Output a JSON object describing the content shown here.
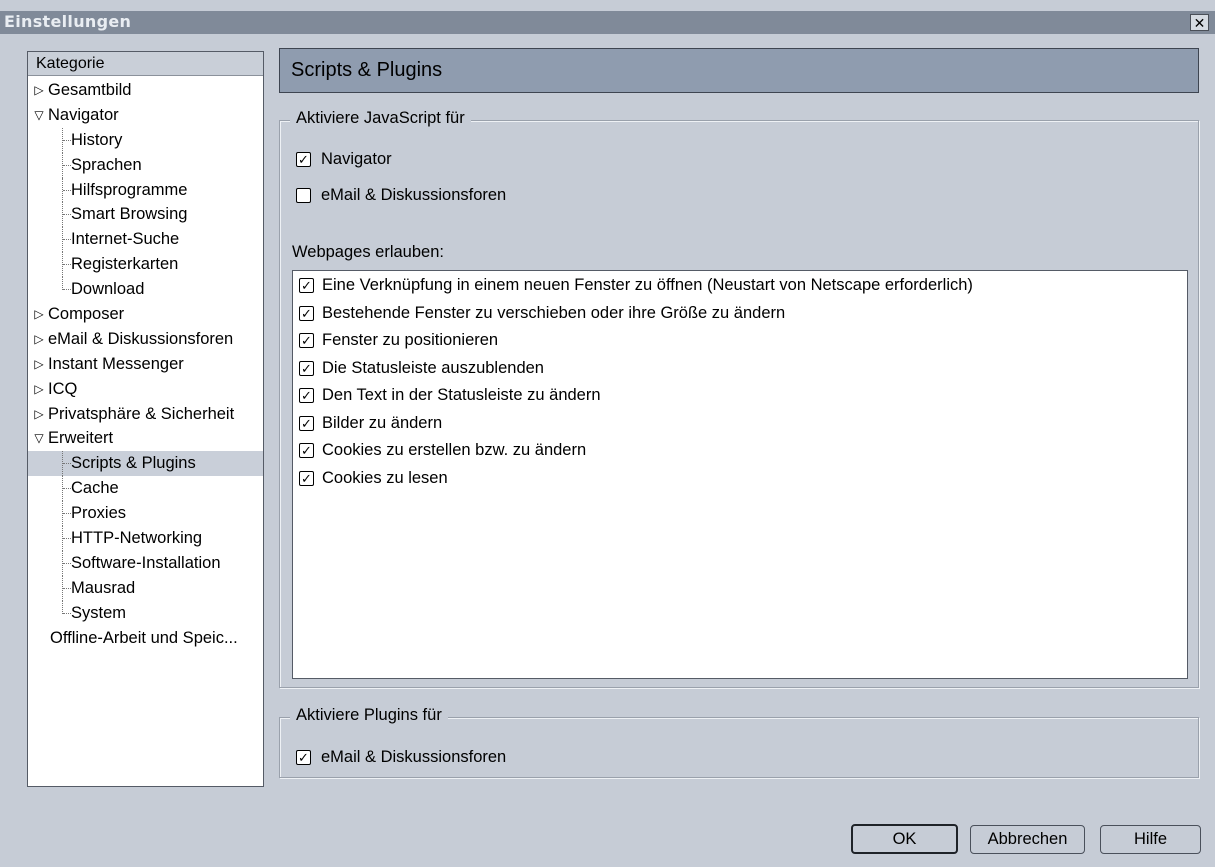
{
  "window": {
    "title": "Einstellungen",
    "close_glyph": "✕"
  },
  "tree": {
    "header": "Kategorie",
    "items": [
      {
        "label": "Gesamtbild",
        "level": "top",
        "arrow": "right"
      },
      {
        "label": "Navigator",
        "level": "top",
        "arrow": "down"
      },
      {
        "label": "History",
        "level": "sub"
      },
      {
        "label": "Sprachen",
        "level": "sub"
      },
      {
        "label": "Hilfsprogramme",
        "level": "sub"
      },
      {
        "label": "Smart Browsing",
        "level": "sub"
      },
      {
        "label": "Internet-Suche",
        "level": "sub"
      },
      {
        "label": "Registerkarten",
        "level": "sub"
      },
      {
        "label": "Download",
        "level": "sub"
      },
      {
        "label": "Composer",
        "level": "top",
        "arrow": "right"
      },
      {
        "label": "eMail & Diskussionsforen",
        "level": "top",
        "arrow": "right"
      },
      {
        "label": "Instant Messenger",
        "level": "top",
        "arrow": "right"
      },
      {
        "label": "ICQ",
        "level": "top",
        "arrow": "right"
      },
      {
        "label": "Privatsphäre & Sicherheit",
        "level": "top",
        "arrow": "right"
      },
      {
        "label": "Erweitert",
        "level": "top",
        "arrow": "down"
      },
      {
        "label": "Scripts & Plugins",
        "level": "sub",
        "selected": true
      },
      {
        "label": "Cache",
        "level": "sub"
      },
      {
        "label": "Proxies",
        "level": "sub"
      },
      {
        "label": "HTTP-Networking",
        "level": "sub"
      },
      {
        "label": "Software-Installation",
        "level": "sub"
      },
      {
        "label": "Mausrad",
        "level": "sub"
      },
      {
        "label": "System",
        "level": "sub"
      },
      {
        "label": "Offline-Arbeit und Speic...",
        "level": "plain"
      }
    ]
  },
  "panel": {
    "title": "Scripts & Plugins"
  },
  "javascript_group": {
    "legend": "Aktiviere JavaScript für",
    "options": [
      {
        "label": "Navigator",
        "checked": true
      },
      {
        "label": "eMail & Diskussionsforen",
        "checked": false
      }
    ],
    "webpages_label": "Webpages erlauben:",
    "permissions": [
      {
        "label": "Eine Verknüpfung in einem neuen Fenster zu öffnen (Neustart von Netscape erforderlich)",
        "checked": true
      },
      {
        "label": "Bestehende Fenster zu verschieben oder ihre Größe zu ändern",
        "checked": true
      },
      {
        "label": "Fenster zu positionieren",
        "checked": true
      },
      {
        "label": "Die Statusleiste auszublenden",
        "checked": true
      },
      {
        "label": "Den Text in der Statusleiste zu ändern",
        "checked": true
      },
      {
        "label": "Bilder zu ändern",
        "checked": true
      },
      {
        "label": "Cookies zu erstellen bzw. zu ändern",
        "checked": true
      },
      {
        "label": "Cookies zu lesen",
        "checked": true
      }
    ]
  },
  "plugins_group": {
    "legend": "Aktiviere Plugins für",
    "options": [
      {
        "label": "eMail & Diskussionsforen",
        "checked": true
      }
    ]
  },
  "buttons": {
    "ok": "OK",
    "cancel": "Abbrechen",
    "help": "Hilfe"
  },
  "check_glyph": "✓"
}
